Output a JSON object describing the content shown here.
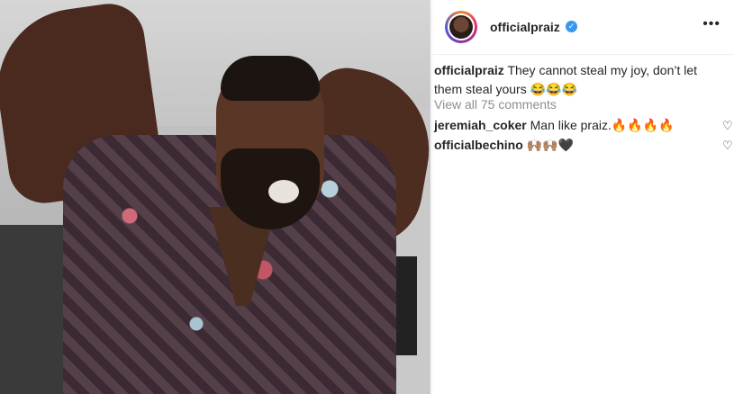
{
  "post": {
    "username": "officialpraiz",
    "verified_badge": "✓",
    "more_icon": "•••"
  },
  "caption": {
    "username": "officialpraiz",
    "text": "They cannot steal my joy, don’t let them steal yours 😂😂😂"
  },
  "view_all_comments": "View all 75 comments",
  "comments": [
    {
      "username": "jeremiah_coker",
      "text": "Man like praiz.🔥🔥🔥🔥",
      "heart": "♡"
    },
    {
      "username": "officialbechino",
      "text": "🙌🏽🙌🏽🖤",
      "heart": "♡"
    }
  ],
  "colors": {
    "verified": "#3897f0",
    "text": "#262626",
    "muted": "#8e8e8e"
  }
}
